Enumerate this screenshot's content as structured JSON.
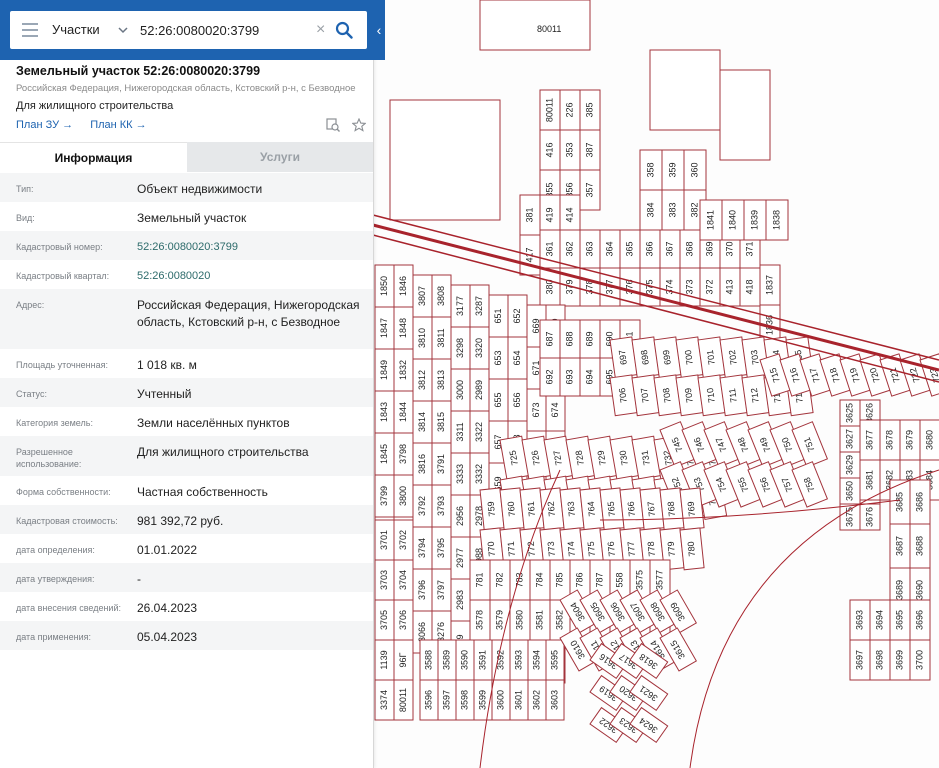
{
  "search": {
    "layer": "Участки",
    "query": "52:26:0080020:3799"
  },
  "parcel": {
    "title": "Земельный участок 52:26:0080020:3799",
    "address": "Российская Федерация, Нижегородская область, Кстовский р-н, с Безводное",
    "use": "Для жилищного строительства",
    "plan_zu": "План ЗУ →",
    "plan_kk": "План КК →"
  },
  "tabs": {
    "info": "Информация",
    "services": "Услуги"
  },
  "rows": [
    {
      "label": "Тип:",
      "value": "Объект недвижимости"
    },
    {
      "label": "Вид:",
      "value": "Земельный участок"
    },
    {
      "label": "Кадастровый номер:",
      "value": "52:26:0080020:3799"
    },
    {
      "label": "Кадастровый квартал:",
      "value": "52:26:0080020"
    },
    {
      "label": "Адрес:",
      "value": "Российская Федерация, Нижегородская область, Кстовский р-н, с Безводное"
    },
    {
      "label": "Площадь уточненная:",
      "value": "1 018 кв. м"
    },
    {
      "label": "Статус:",
      "value": "Учтенный"
    },
    {
      "label": "Категория земель:",
      "value": "Земли населённых пунктов"
    },
    {
      "label": "Разрешенное использование:",
      "value": "Для жилищного строительства"
    },
    {
      "label": "Форма собственности:",
      "value": "Частная собственность"
    },
    {
      "label": "Кадастровая стоимость:",
      "value": "981 392,72 руб."
    },
    {
      "label": "дата определения:",
      "value": "01.01.2022"
    },
    {
      "label": "дата утверждения:",
      "value": "-"
    },
    {
      "label": "дата внесения сведений:",
      "value": "26.04.2023"
    },
    {
      "label": "дата применения:",
      "value": "05.04.2023"
    }
  ],
  "map": {
    "labels": [
      "80011",
      "226",
      "385",
      "416",
      "353",
      "387",
      "355",
      "356",
      "357",
      "358",
      "359",
      "360",
      "384",
      "383",
      "382",
      "381",
      "419",
      "414",
      "417",
      "411",
      "415",
      "361",
      "362",
      "363",
      "364",
      "365",
      "366",
      "367",
      "368",
      "369",
      "370",
      "371",
      "380",
      "379",
      "378",
      "377",
      "376",
      "375",
      "374",
      "373",
      "372",
      "413",
      "418",
      "1841",
      "1840",
      "1839",
      "1838",
      "1837",
      "1836",
      "1850",
      "1846",
      "1847",
      "1848",
      "1849",
      "1832",
      "1843",
      "1844",
      "1845",
      "3798",
      "3799",
      "3800",
      "3801",
      "3802",
      "3803",
      "3804",
      "3805",
      "3806",
      "3807",
      "3808",
      "3810",
      "3811",
      "3812",
      "3813",
      "3814",
      "3815",
      "3816",
      "3791",
      "3792",
      "3793",
      "3794",
      "3795",
      "3796",
      "3797",
      "3066",
      "3276",
      "3177",
      "3287",
      "3298",
      "3320",
      "3000",
      "2989",
      "3311",
      "3322",
      "3333",
      "3332",
      "2956",
      "2978",
      "2977",
      "2988",
      "2983",
      "648",
      "649",
      "650",
      "651",
      "652",
      "653",
      "654",
      "655",
      "656",
      "657",
      "658",
      "659",
      "660",
      "661",
      "662",
      "663",
      "664",
      "665",
      "666",
      "667",
      "668",
      "669",
      "670",
      "671",
      "672",
      "673",
      "674",
      "675",
      "676",
      "677",
      "678",
      "679",
      "680",
      "681",
      "682",
      "683",
      "684",
      "685",
      "686",
      "687",
      "688",
      "689",
      "690",
      "691",
      "692",
      "693",
      "694",
      "695",
      "696",
      "697",
      "698",
      "699",
      "700",
      "701",
      "702",
      "703",
      "704",
      "705",
      "706",
      "707",
      "708",
      "709",
      "710",
      "711",
      "712",
      "713",
      "714",
      "715",
      "716",
      "717",
      "718",
      "719",
      "720",
      "721",
      "722",
      "723",
      "724",
      "725",
      "726",
      "727",
      "728",
      "729",
      "730",
      "731",
      "732",
      "733",
      "734",
      "735",
      "736",
      "737",
      "738",
      "739",
      "740",
      "741",
      "742",
      "743",
      "744",
      "745",
      "746",
      "747",
      "748",
      "749",
      "750",
      "751",
      "752",
      "753",
      "754",
      "755",
      "756",
      "757",
      "758",
      "759",
      "760",
      "761",
      "762",
      "763",
      "764",
      "765",
      "766",
      "767",
      "768",
      "769",
      "770",
      "771",
      "772",
      "773",
      "774",
      "775",
      "776",
      "777",
      "778",
      "779",
      "780",
      "781",
      "782",
      "783",
      "784",
      "785",
      "786",
      "787",
      "558",
      "3575",
      "3577",
      "3578",
      "3579",
      "3580",
      "3581",
      "3582",
      "3583",
      "3584",
      "3585",
      "3586",
      "3587",
      "3588",
      "3589",
      "3590",
      "3591",
      "3592",
      "3593",
      "3594",
      "3595",
      "3596",
      "3597",
      "3598",
      "3599",
      "3600",
      "3601",
      "3602",
      "3603",
      "3604",
      "3605",
      "3606",
      "3607",
      "3608",
      "3609",
      "3610",
      "3611",
      "3612",
      "3613",
      "3614",
      "3615",
      "3616",
      "3617",
      "3618",
      "3619",
      "3620",
      "3621",
      "3622",
      "3623",
      "3624",
      "3625",
      "3626",
      "3627",
      "3628",
      "3629",
      "3630",
      "3650",
      "3674",
      "3675",
      "3676",
      "3677",
      "3678",
      "3679",
      "3680",
      "3681",
      "3682",
      "3683",
      "3684",
      "3685",
      "3686",
      "3687",
      "3688",
      "3689",
      "3690",
      "3691",
      "3692",
      "3693",
      "3694",
      "3695",
      "3696",
      "3697",
      "3698",
      "3699",
      "3700",
      "3701",
      "3702",
      "3703",
      "3704",
      "3705",
      "3706",
      "1139",
      "96Г",
      "3374"
    ],
    "highlight_label": "3799",
    "highlight_color": "#f2ef3a",
    "boundary_color": "#a8232c"
  }
}
